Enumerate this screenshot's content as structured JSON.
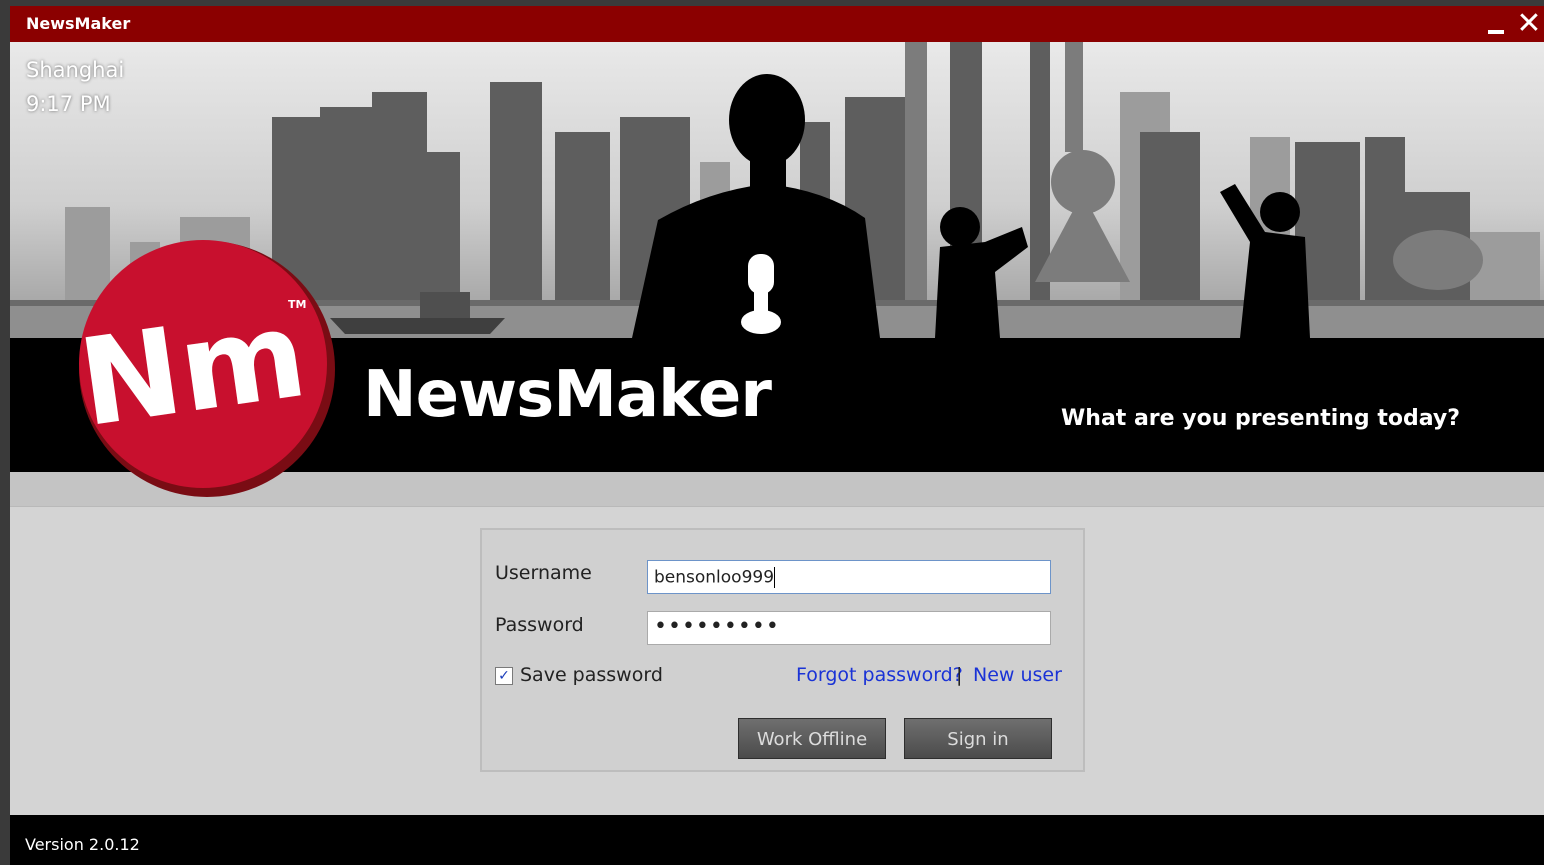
{
  "window": {
    "title": "NewsMaker",
    "minimize_icon": "minimize-icon",
    "close_icon": "close-icon",
    "close_glyph": "✕"
  },
  "banner": {
    "city": "Shanghai",
    "time": "9:17 PM",
    "brand_name": "NewsMaker",
    "tagline": "What are you presenting today?"
  },
  "logo": {
    "letters": "Nm",
    "trademark": "TM",
    "accent_color": "#c8102e"
  },
  "login": {
    "username_label": "Username",
    "username_value": "bensonloo999",
    "password_label": "Password",
    "password_mask": "•••••••••",
    "save_password_label": "Save password",
    "save_password_checked": true,
    "checkmark_glyph": "✓",
    "forgot_link": "Forgot password?",
    "separator": "|",
    "new_user_link": "New user",
    "work_offline_label": "Work Offline",
    "sign_in_label": "Sign in"
  },
  "footer": {
    "version": "Version 2.0.12"
  },
  "colors": {
    "titlebar": "#8b0000",
    "link": "#1a33d6",
    "band": "#000000"
  }
}
